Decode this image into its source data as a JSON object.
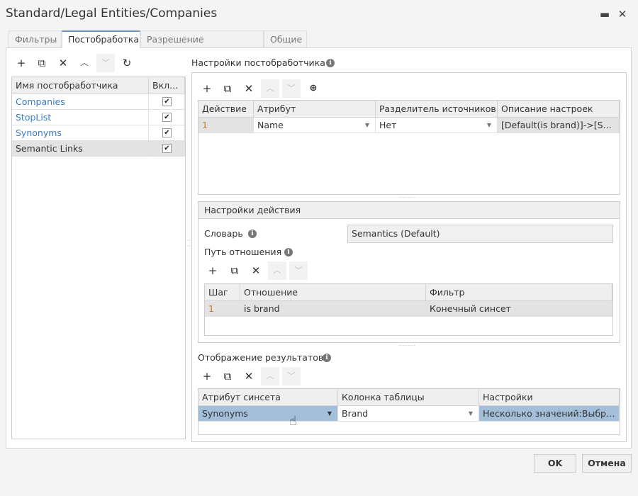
{
  "window": {
    "title": "Standard/Legal Entities/Companies",
    "maximize_icon": "maximize-icon",
    "close_icon": "close-icon"
  },
  "tabs": [
    {
      "label": "Фильтры"
    },
    {
      "label": "Постобработка",
      "active": true
    },
    {
      "label": "Разрешение конфликтов"
    },
    {
      "label": "Общие"
    }
  ],
  "postprocessors": {
    "columns": [
      "Имя постобработчика",
      "Вкл..."
    ],
    "rows": [
      {
        "name": "Companies",
        "enabled": true,
        "link": true
      },
      {
        "name": "StopList",
        "enabled": true,
        "link": true
      },
      {
        "name": "Synonyms",
        "enabled": true,
        "link": true
      },
      {
        "name": "Semantic Links",
        "enabled": true,
        "link": false,
        "selected": true
      }
    ]
  },
  "settings": {
    "title": "Настройки постобработчика",
    "columns": [
      "Действие",
      "Атрибут",
      "Разделитель источников",
      "Описание настроек"
    ],
    "rows": [
      {
        "action": "1",
        "attribute": "Name",
        "separator": "Нет",
        "description": "[Default(is brand)]->[Syn..."
      }
    ]
  },
  "action_settings": {
    "title": "Настройки действия",
    "dictionary_label": "Словарь",
    "dictionary_value": "Semantics (Default)",
    "path_label": "Путь отношения",
    "columns": [
      "Шаг",
      "Отношение",
      "Фильтр"
    ],
    "rows": [
      {
        "step": "1",
        "relation": "is brand",
        "filter": "Конечный синсет"
      }
    ]
  },
  "results": {
    "title": "Отображение результатов",
    "columns": [
      "Атрибут синсета",
      "Колонка таблицы",
      "Настройки"
    ],
    "rows": [
      {
        "synset_attribute": "Synonyms",
        "table_column": "Brand",
        "settings": "Несколько значений:Выбра..."
      }
    ]
  },
  "buttons": {
    "ok": "OK",
    "cancel": "Отмена"
  },
  "colors": {
    "link": "#3a7bc8",
    "selected_row": "#a4bfd9",
    "active_tab_border": "#6d95bd"
  }
}
